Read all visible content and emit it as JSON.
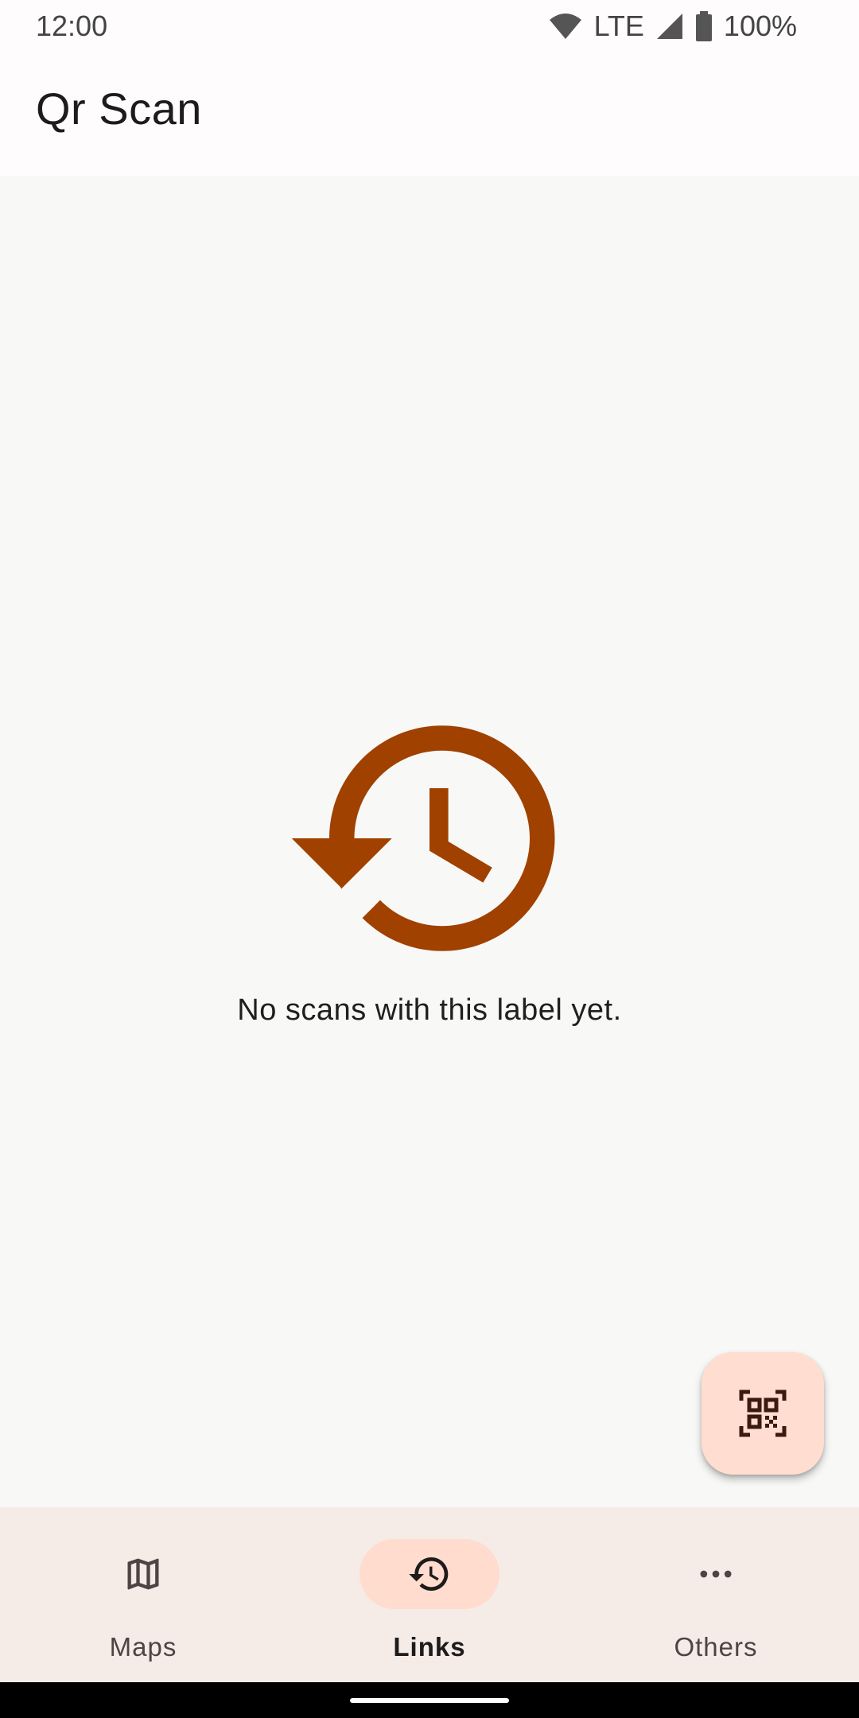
{
  "status_bar": {
    "time": "12:00",
    "network": "LTE",
    "battery": "100%",
    "icons": [
      "wifi-icon",
      "signal-icon",
      "battery-icon"
    ]
  },
  "app_bar": {
    "title": "Qr Scan"
  },
  "empty_state": {
    "icon": "history-icon",
    "message": "No scans with this label yet.",
    "icon_color": "#a04100"
  },
  "fab": {
    "icon": "qr-scan-icon",
    "color": "#ffddd0"
  },
  "bottom_nav": {
    "items": [
      {
        "label": "Maps",
        "icon": "map-icon",
        "active": false
      },
      {
        "label": "Links",
        "icon": "history-icon",
        "active": true
      },
      {
        "label": "Others",
        "icon": "more-horizontal-icon",
        "active": false
      }
    ],
    "active_indicator_color": "#ffdccd"
  }
}
